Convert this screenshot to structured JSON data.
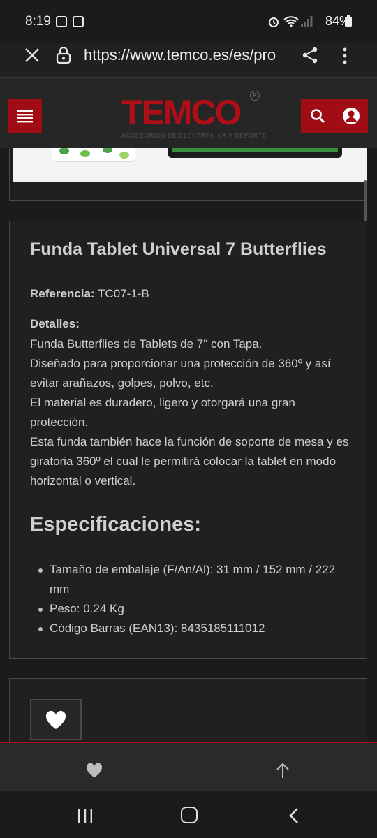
{
  "status_bar": {
    "time": "8:19",
    "battery": "84%"
  },
  "browser": {
    "url": "https://www.temco.es/es/pro"
  },
  "header": {
    "logo_text": "TEMCO",
    "logo_tagline": "ACCESORIOS DE ELECTRÓNICA Y DEPORTE",
    "brand_color": "#a00d14"
  },
  "product": {
    "title": "Funda Tablet Universal 7 Butterflies",
    "reference_label": "Referencia:",
    "reference_value": "TC07-1-B",
    "details_label": "Detalles:",
    "details_lines": [
      "Funda Butterflies de Tablets de 7\" con Tapa.",
      "Diseñado para proporcionar una protección de 360º y así evitar arañazos, golpes, polvo, etc.",
      "El material es duradero, ligero y otorgará una gran protección.",
      "Esta funda también hace la función de soporte de mesa y es giratoria 360º el cual le permitirá colocar la tablet en modo horizontal o vertical."
    ],
    "specs_title": "Especificaciones:",
    "specs": [
      "Tamaño de embalaje (F/An/Al): 31 mm / 152 mm / 222 mm",
      "Peso: 0.24 Kg",
      "Código Barras (EAN13): 8435185111012"
    ]
  },
  "icons": {
    "close": "close-icon",
    "lock": "lock-icon",
    "share": "share-icon",
    "more": "more-icon",
    "menu": "menu-icon",
    "search": "search-icon",
    "user": "user-icon",
    "heart": "heart-icon",
    "up": "arrow-up-icon"
  }
}
